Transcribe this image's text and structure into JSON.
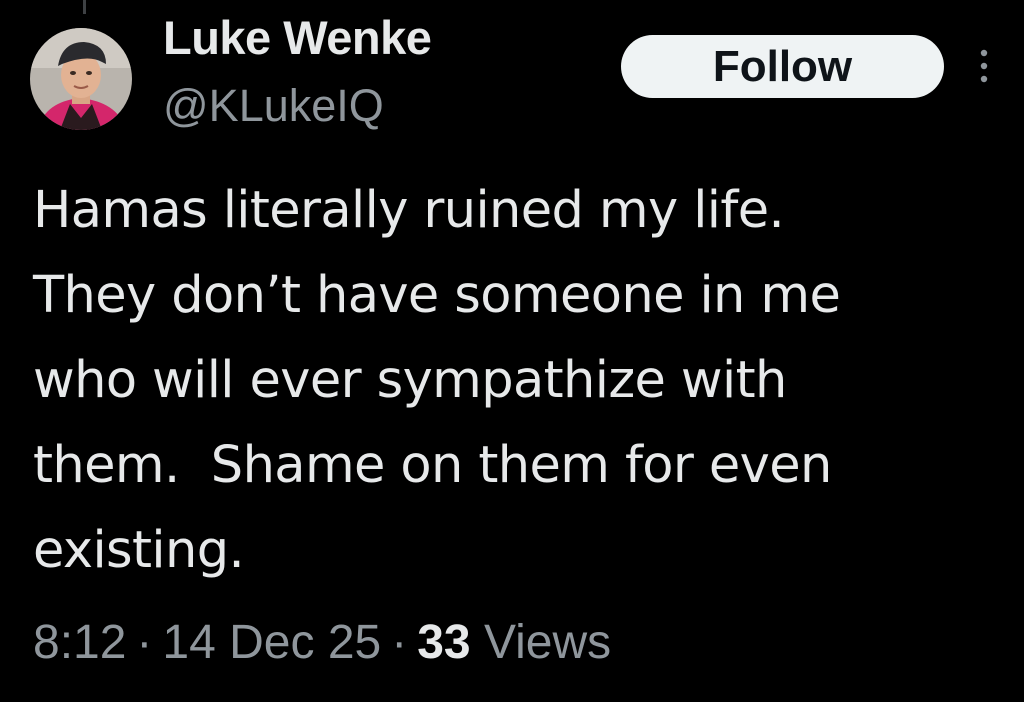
{
  "tweet": {
    "author": {
      "name": "Luke Wenke",
      "handle": "@KLukeIQ",
      "avatar_icon": "profile-photo"
    },
    "follow_label": "Follow",
    "more_icon": "more-vertical-icon",
    "text_lines": [
      "Hamas literally ruined my life.",
      "They don’t have someone in me",
      "who will ever sympathize with",
      "them.  Shame on them for even",
      "existing."
    ],
    "meta": {
      "time": "8:12",
      "separator": "·",
      "date": "14 Dec 25",
      "views_count": "33",
      "views_label": "Views"
    }
  },
  "colors": {
    "background": "#000000",
    "primary_text": "#e7e9ea",
    "secondary_text": "#8f969c",
    "follow_bg": "#eff3f4",
    "follow_text": "#0f1419"
  }
}
